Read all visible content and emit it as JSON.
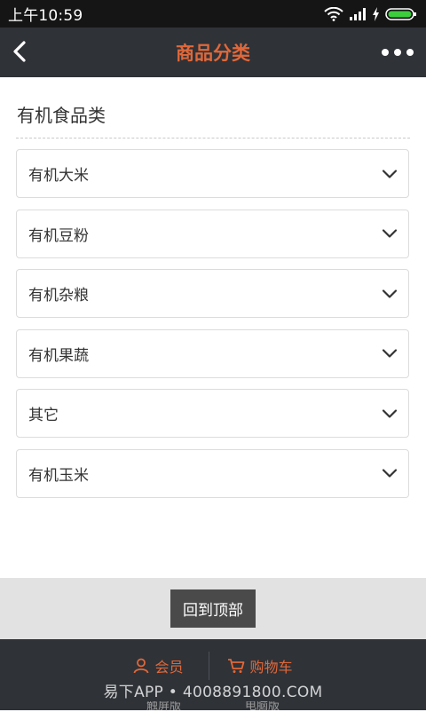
{
  "status_bar": {
    "time": "上午10:59",
    "icons": [
      "wifi-icon",
      "signal-icon",
      "charging-icon",
      "battery-icon"
    ]
  },
  "header": {
    "title": "商品分类",
    "back_icon": "chevron-left-icon",
    "more_icon": "more-dots-icon"
  },
  "section": {
    "title": "有机食品类",
    "items": [
      {
        "label": "有机大米"
      },
      {
        "label": "有机豆粉"
      },
      {
        "label": "有机杂粮"
      },
      {
        "label": "有机果蔬"
      },
      {
        "label": "其它"
      },
      {
        "label": "有机玉米"
      }
    ]
  },
  "back_to_top": {
    "label": "回到顶部"
  },
  "footer": {
    "member_label": "会员",
    "cart_label": "购物车",
    "touch_version": "触屏版",
    "pc_version": "电脑版"
  },
  "watermark": "易下APP • 4008891800.COM",
  "colors": {
    "accent": "#e0683a",
    "header_bg": "#2f3237",
    "status_bg": "#151515"
  }
}
